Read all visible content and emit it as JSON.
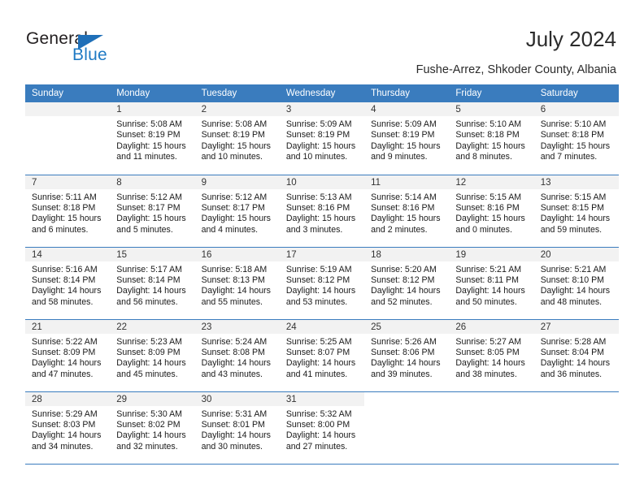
{
  "brand": {
    "name_dark": "General",
    "name_light": "Blue",
    "triangle_color": "#1f6fb8",
    "blue_color": "#1f7ac4"
  },
  "header": {
    "title": "July 2024",
    "subtitle": "Fushe-Arrez, Shkoder County, Albania",
    "header_bg": "#3a7cbe",
    "daynum_bg": "#f2f2f2"
  },
  "weekdays": [
    "Sunday",
    "Monday",
    "Tuesday",
    "Wednesday",
    "Thursday",
    "Friday",
    "Saturday"
  ],
  "labels": {
    "sunrise_prefix": "Sunrise:",
    "sunset_prefix": "Sunset:",
    "daylight_prefix": "Daylight:"
  },
  "weeks": [
    [
      {
        "day": "",
        "empty": true
      },
      {
        "day": "1",
        "sunrise": "Sunrise: 5:08 AM",
        "sunset": "Sunset: 8:19 PM",
        "daylight1": "Daylight: 15 hours",
        "daylight2": "and 11 minutes."
      },
      {
        "day": "2",
        "sunrise": "Sunrise: 5:08 AM",
        "sunset": "Sunset: 8:19 PM",
        "daylight1": "Daylight: 15 hours",
        "daylight2": "and 10 minutes."
      },
      {
        "day": "3",
        "sunrise": "Sunrise: 5:09 AM",
        "sunset": "Sunset: 8:19 PM",
        "daylight1": "Daylight: 15 hours",
        "daylight2": "and 10 minutes."
      },
      {
        "day": "4",
        "sunrise": "Sunrise: 5:09 AM",
        "sunset": "Sunset: 8:19 PM",
        "daylight1": "Daylight: 15 hours",
        "daylight2": "and 9 minutes."
      },
      {
        "day": "5",
        "sunrise": "Sunrise: 5:10 AM",
        "sunset": "Sunset: 8:18 PM",
        "daylight1": "Daylight: 15 hours",
        "daylight2": "and 8 minutes."
      },
      {
        "day": "6",
        "sunrise": "Sunrise: 5:10 AM",
        "sunset": "Sunset: 8:18 PM",
        "daylight1": "Daylight: 15 hours",
        "daylight2": "and 7 minutes."
      }
    ],
    [
      {
        "day": "7",
        "sunrise": "Sunrise: 5:11 AM",
        "sunset": "Sunset: 8:18 PM",
        "daylight1": "Daylight: 15 hours",
        "daylight2": "and 6 minutes."
      },
      {
        "day": "8",
        "sunrise": "Sunrise: 5:12 AM",
        "sunset": "Sunset: 8:17 PM",
        "daylight1": "Daylight: 15 hours",
        "daylight2": "and 5 minutes."
      },
      {
        "day": "9",
        "sunrise": "Sunrise: 5:12 AM",
        "sunset": "Sunset: 8:17 PM",
        "daylight1": "Daylight: 15 hours",
        "daylight2": "and 4 minutes."
      },
      {
        "day": "10",
        "sunrise": "Sunrise: 5:13 AM",
        "sunset": "Sunset: 8:16 PM",
        "daylight1": "Daylight: 15 hours",
        "daylight2": "and 3 minutes."
      },
      {
        "day": "11",
        "sunrise": "Sunrise: 5:14 AM",
        "sunset": "Sunset: 8:16 PM",
        "daylight1": "Daylight: 15 hours",
        "daylight2": "and 2 minutes."
      },
      {
        "day": "12",
        "sunrise": "Sunrise: 5:15 AM",
        "sunset": "Sunset: 8:16 PM",
        "daylight1": "Daylight: 15 hours",
        "daylight2": "and 0 minutes."
      },
      {
        "day": "13",
        "sunrise": "Sunrise: 5:15 AM",
        "sunset": "Sunset: 8:15 PM",
        "daylight1": "Daylight: 14 hours",
        "daylight2": "and 59 minutes."
      }
    ],
    [
      {
        "day": "14",
        "sunrise": "Sunrise: 5:16 AM",
        "sunset": "Sunset: 8:14 PM",
        "daylight1": "Daylight: 14 hours",
        "daylight2": "and 58 minutes."
      },
      {
        "day": "15",
        "sunrise": "Sunrise: 5:17 AM",
        "sunset": "Sunset: 8:14 PM",
        "daylight1": "Daylight: 14 hours",
        "daylight2": "and 56 minutes."
      },
      {
        "day": "16",
        "sunrise": "Sunrise: 5:18 AM",
        "sunset": "Sunset: 8:13 PM",
        "daylight1": "Daylight: 14 hours",
        "daylight2": "and 55 minutes."
      },
      {
        "day": "17",
        "sunrise": "Sunrise: 5:19 AM",
        "sunset": "Sunset: 8:12 PM",
        "daylight1": "Daylight: 14 hours",
        "daylight2": "and 53 minutes."
      },
      {
        "day": "18",
        "sunrise": "Sunrise: 5:20 AM",
        "sunset": "Sunset: 8:12 PM",
        "daylight1": "Daylight: 14 hours",
        "daylight2": "and 52 minutes."
      },
      {
        "day": "19",
        "sunrise": "Sunrise: 5:21 AM",
        "sunset": "Sunset: 8:11 PM",
        "daylight1": "Daylight: 14 hours",
        "daylight2": "and 50 minutes."
      },
      {
        "day": "20",
        "sunrise": "Sunrise: 5:21 AM",
        "sunset": "Sunset: 8:10 PM",
        "daylight1": "Daylight: 14 hours",
        "daylight2": "and 48 minutes."
      }
    ],
    [
      {
        "day": "21",
        "sunrise": "Sunrise: 5:22 AM",
        "sunset": "Sunset: 8:09 PM",
        "daylight1": "Daylight: 14 hours",
        "daylight2": "and 47 minutes."
      },
      {
        "day": "22",
        "sunrise": "Sunrise: 5:23 AM",
        "sunset": "Sunset: 8:09 PM",
        "daylight1": "Daylight: 14 hours",
        "daylight2": "and 45 minutes."
      },
      {
        "day": "23",
        "sunrise": "Sunrise: 5:24 AM",
        "sunset": "Sunset: 8:08 PM",
        "daylight1": "Daylight: 14 hours",
        "daylight2": "and 43 minutes."
      },
      {
        "day": "24",
        "sunrise": "Sunrise: 5:25 AM",
        "sunset": "Sunset: 8:07 PM",
        "daylight1": "Daylight: 14 hours",
        "daylight2": "and 41 minutes."
      },
      {
        "day": "25",
        "sunrise": "Sunrise: 5:26 AM",
        "sunset": "Sunset: 8:06 PM",
        "daylight1": "Daylight: 14 hours",
        "daylight2": "and 39 minutes."
      },
      {
        "day": "26",
        "sunrise": "Sunrise: 5:27 AM",
        "sunset": "Sunset: 8:05 PM",
        "daylight1": "Daylight: 14 hours",
        "daylight2": "and 38 minutes."
      },
      {
        "day": "27",
        "sunrise": "Sunrise: 5:28 AM",
        "sunset": "Sunset: 8:04 PM",
        "daylight1": "Daylight: 14 hours",
        "daylight2": "and 36 minutes."
      }
    ],
    [
      {
        "day": "28",
        "sunrise": "Sunrise: 5:29 AM",
        "sunset": "Sunset: 8:03 PM",
        "daylight1": "Daylight: 14 hours",
        "daylight2": "and 34 minutes."
      },
      {
        "day": "29",
        "sunrise": "Sunrise: 5:30 AM",
        "sunset": "Sunset: 8:02 PM",
        "daylight1": "Daylight: 14 hours",
        "daylight2": "and 32 minutes."
      },
      {
        "day": "30",
        "sunrise": "Sunrise: 5:31 AM",
        "sunset": "Sunset: 8:01 PM",
        "daylight1": "Daylight: 14 hours",
        "daylight2": "and 30 minutes."
      },
      {
        "day": "31",
        "sunrise": "Sunrise: 5:32 AM",
        "sunset": "Sunset: 8:00 PM",
        "daylight1": "Daylight: 14 hours",
        "daylight2": "and 27 minutes."
      },
      {
        "day": "",
        "empty": true,
        "blank": true
      },
      {
        "day": "",
        "empty": true,
        "blank": true
      },
      {
        "day": "",
        "empty": true,
        "blank": true
      }
    ]
  ]
}
